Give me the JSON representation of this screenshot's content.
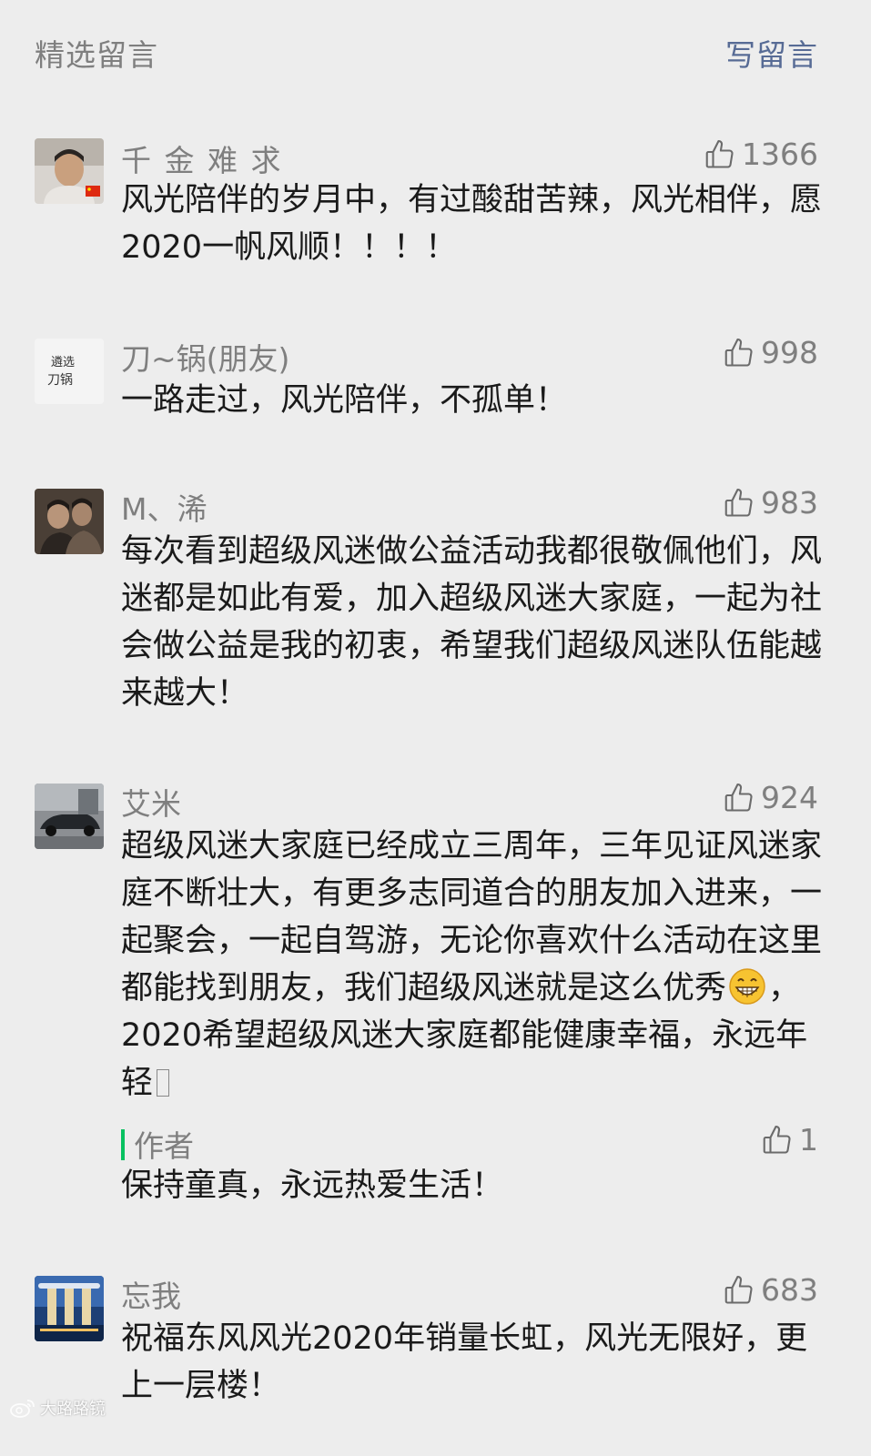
{
  "header": {
    "title": "精选留言",
    "write_label": "写留言"
  },
  "comments": [
    {
      "nickname": "千 金 难 求",
      "likes": "1366",
      "text": "风光陪伴的岁月中，有过酸甜苦辣，风光相伴，愿2020一帆风顺！！！！"
    },
    {
      "nickname": "刀~锅(朋友)",
      "likes": "998",
      "text": "一路走过，风光陪伴，不孤单！"
    },
    {
      "nickname": "M、浠",
      "likes": "983",
      "text": "每次看到超级风迷做公益活动我都很敬佩他们，风迷都是如此有爱，加入超级风迷大家庭，一起为社会做公益是我的初衷，希望我们超级风迷队伍能越来越大！"
    },
    {
      "nickname": "艾米",
      "likes": "924",
      "text_a": "超级风迷大家庭已经成立三周年，三年见证风迷家庭不断壮大，有更多志同道合的朋友加入进来，一起聚会，一起自驾游，无论你喜欢什么活动在这里都能找到朋友，我们超级风迷就是这么优秀",
      "emoji": "grinning-face",
      "text_b": "，2020希望超级风迷大家庭都能健康幸福，永远年轻",
      "reply": {
        "label": "作者",
        "likes": "1",
        "text": "保持童真，永远热爱生活！"
      }
    },
    {
      "nickname": "忘我",
      "likes": "683",
      "text": "祝福东风风光2020年销量长虹，风光无限好，更上一层楼！"
    }
  ],
  "watermark": {
    "text": "大路路镜"
  },
  "colors": {
    "link": "#576b95",
    "muted": "#7f7f7f",
    "accent": "#07c160",
    "background": "#ededed"
  },
  "icons": {
    "like": "thumbs-up-icon",
    "flag": "china-flag-icon"
  }
}
